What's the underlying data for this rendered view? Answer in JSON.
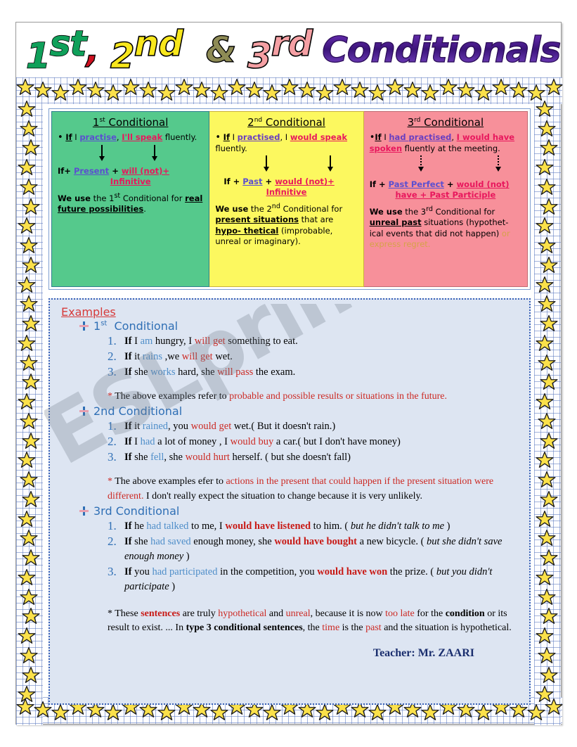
{
  "title": {
    "ord1_num": "1",
    "ord1_sup": "st",
    "comma": ",",
    "ord2_num": "2",
    "ord2_sup": "nd",
    "amp": "&",
    "ord3_num": "3",
    "ord3_sup": "rd",
    "main": "Conditionals",
    "colors": {
      "first": "#10a05a",
      "second": "#f8e71c",
      "third": "#f5a0a4",
      "main": "#4a1f8f",
      "comma": "#d01020",
      "amp": "#8e8b55"
    }
  },
  "boxes": [
    {
      "heading_num": "1",
      "heading_sup": "st",
      "heading_word": "Conditional",
      "bg": "#55c98c",
      "example": {
        "if": "If",
        "mid1": " I ",
        "cond": "practise",
        "mid2": ", ",
        "result": "I'll speak",
        "tail": " fluently."
      },
      "formula": {
        "lead": "If+",
        "part1": "Present",
        "plus": "+",
        "part2": "will (not)+",
        "part3": "Infinitive"
      },
      "use": {
        "we_use": "We use",
        "mid": " the 1",
        "sup": "st",
        "mid2": " Conditional for ",
        "emph": "real future possibilities",
        "tail": "."
      }
    },
    {
      "heading_num": "2",
      "heading_sup": "nd",
      "heading_word": "Conditional",
      "bg": "#fcf85f",
      "example": {
        "if": "If",
        "mid1": " I ",
        "cond": "practised",
        "mid2": ", I ",
        "result": "would speak",
        "tail": " fluently."
      },
      "formula": {
        "lead": "If  +",
        "part1": "Past",
        "plus": "+",
        "part2": "would (not)+",
        "part3": "Infinitive"
      },
      "use": {
        "we_use": "We use",
        "mid": " the 2",
        "sup": "nd",
        "mid2": " Conditional for ",
        "emph": "present situations",
        "mid3": " that are ",
        "emph2": "hypo- thetical",
        "tail": " (improbable, unreal or imaginary)."
      }
    },
    {
      "heading_num": "3",
      "heading_sup": "rd",
      "heading_word": "Conditional",
      "bg": "#f7909a",
      "example": {
        "if": "If",
        "mid1": " I ",
        "cond": "had practised",
        "mid2": ", ",
        "result": "I would have spoken",
        "tail": " fluently at the meeting."
      },
      "formula": {
        "lead": "If +",
        "part1": "Past Perfect",
        "plus": "+",
        "part2": "would (not)",
        "part3": "have + Past Participle"
      },
      "use": {
        "we_use": "We use",
        "mid": " the 3",
        "sup": "rd",
        "mid2": " Conditional for ",
        "emph": "unreal past",
        "mid3": " situations (hypothet-ical events that did not happen) ",
        "fade": "or express regret."
      }
    }
  ],
  "panel": {
    "examples_label": "Examples",
    "groups": [
      {
        "head_num": "1",
        "head_sup": "st",
        "head_word": "Conditional",
        "items": [
          {
            "n": "1.",
            "p1": "If",
            "p2": " I ",
            "cond": "am",
            "p3": " hungry, I ",
            "res": "will get",
            "p4": " something to eat."
          },
          {
            "n": "2.",
            "p1": "If",
            "p2": " it ",
            "cond": "rains",
            "p3": " ,we ",
            "res": "will get",
            "p4": " wet."
          },
          {
            "n": "3.",
            "p1": "If",
            "p2": " she ",
            "cond": "works",
            "p3": " hard, she ",
            "res": "will pass",
            "p4": " the exam."
          }
        ],
        "note_star": "* ",
        "note_black": "The above examples refer to ",
        "note_red": "probable and possible results or situations in the future.",
        "note_black2": ""
      },
      {
        "head_num": "",
        "head_sup": "",
        "head_word": "2nd Conditional",
        "items": [
          {
            "n": "1.",
            "p1": "If",
            "p2": " it ",
            "cond": "rained",
            "p3": ", you ",
            "res": "would get",
            "p4": " wet.( But it doesn't rain.)"
          },
          {
            "n": "2.",
            "p1": "If",
            "p2": " I ",
            "cond": "had",
            "p3": " a lot of money , I ",
            "res": "would buy",
            "p4": " a car.( but I  don't have money)"
          },
          {
            "n": "3.",
            "p1": "If",
            "p2": " she ",
            "cond": "fell",
            "p3": ", she ",
            "res": "would hurt",
            "p4": " herself. ( but she doesn't fall)"
          }
        ],
        "note_star": "* ",
        "note_black": "The above examples efer to ",
        "note_red": "actions in the present that could happen if the present situation were different.",
        "note_black2": " I don't really expect the situation to change because it is very unlikely."
      },
      {
        "head_num": "",
        "head_sup": "",
        "head_word": "3rd Conditional",
        "items": [
          {
            "n": "1.",
            "p1": "If",
            "p2": " he ",
            "cond": "had talked",
            "p3": " to me, I ",
            "res": "would have listened",
            "p4": " to him. ( ",
            "paren": "but he didn't talk to me",
            "p5": " )"
          },
          {
            "n": "2.",
            "p1": "If",
            "p2": " she ",
            "cond": "had saved",
            "p3": " enough money, she ",
            "res": "would have bought",
            "p4": " a new bicycle. ( ",
            "paren": "but she didn't save enough money",
            "p5": " )"
          },
          {
            "n": "3.",
            "p1": "If",
            "p2": " you ",
            "cond": "had participated",
            "p3": " in the competition, you ",
            "res": "would have won",
            "p4": "  the prize. ( ",
            "paren": "but you didn't participate",
            "p5": " )"
          }
        ]
      }
    ],
    "final_note": {
      "star": "* ",
      "s1": "These ",
      "b1": "sentences",
      "s2": " are truly ",
      "r1": "hypothetical",
      "s3": " and ",
      "r2": "unreal",
      "s4": ", because it is now ",
      "r3": "too late",
      "s5": " for the ",
      "b2": "condition",
      "s6": " or its result to exist. ... In ",
      "b3": "type 3 conditional sentences",
      "s7": ", the ",
      "r4": "time",
      "s8": " is the ",
      "r5": "past",
      "s9": " and the situation is hypothetical."
    },
    "signature": "Teacher: Mr. ZAARI"
  },
  "watermark": "ESLprintables.com"
}
